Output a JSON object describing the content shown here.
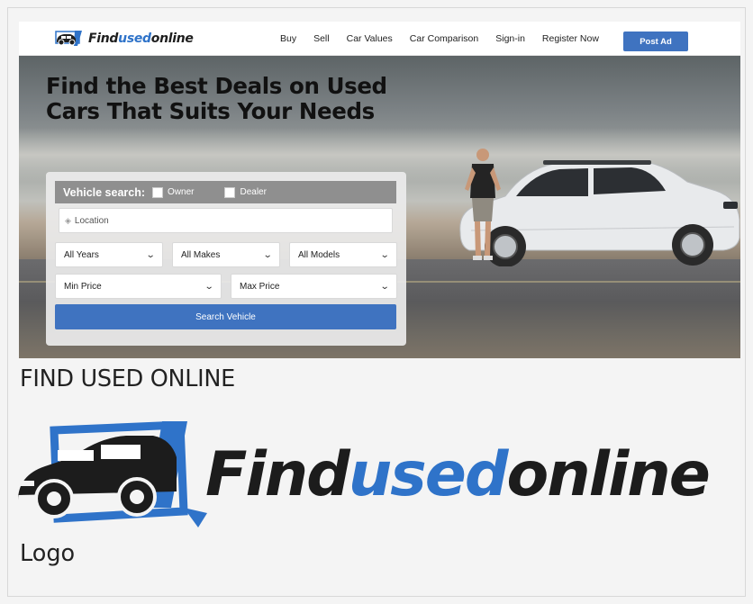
{
  "site": {
    "brand_prefix": "Find",
    "brand_middle": "used",
    "brand_suffix": "online",
    "accent_color": "#3f73c0",
    "nav": [
      "Buy",
      "Sell",
      "Car Values",
      "Car Comparison",
      "Sign-in",
      "Register Now"
    ],
    "post_ad_label": "Post Ad"
  },
  "hero": {
    "headline": "Find the Best Deals on Used Cars That Suits Your Needs"
  },
  "search": {
    "title": "Vehicle search:",
    "owner_label": "Owner",
    "dealer_label": "Dealer",
    "location_placeholder": "Location",
    "years": "All Years",
    "makes": "All Makes",
    "models": "All Models",
    "min_price": "Min Price",
    "max_price": "Max Price",
    "button_label": "Search Vehicle"
  },
  "page": {
    "section_title": "FIND USED ONLINE",
    "logo_caption": "Logo"
  }
}
